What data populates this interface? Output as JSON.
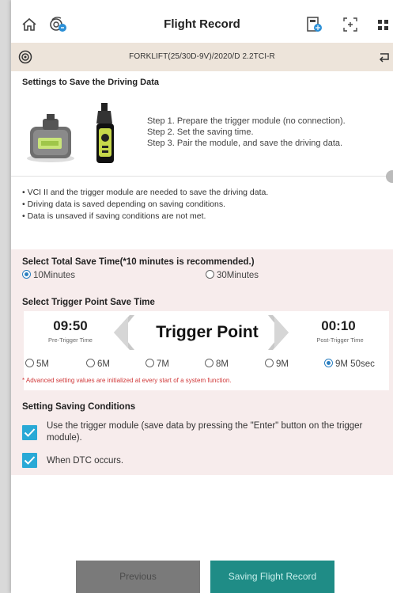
{
  "header": {
    "title": "Flight Record",
    "icons": [
      "home-icon",
      "vci-connection-icon",
      "battery-vci-icon",
      "screen-capture-icon",
      "apps-grid-icon"
    ]
  },
  "vehicle": {
    "text": "FORKLIFT(25/30D-9V)/2020/D 2.2TCI-R",
    "icons": [
      "gear-badge-icon",
      "return-icon"
    ]
  },
  "settings_section": {
    "title": "Settings to Save the Driving Data",
    "steps": [
      "Step 1. Prepare the trigger module (no connection).",
      "Step 2. Set the saving time.",
      "Step 3. Pair the module, and save the driving data."
    ],
    "bullets": [
      "• VCI II and the trigger module are needed to save the driving data.",
      "• Driving data is saved depending on saving conditions.",
      "• Data is unsaved if saving conditions are not met."
    ]
  },
  "total_save_time": {
    "title": "Select Total Save Time(*10 minutes is recommended.)",
    "options": [
      "10Minutes",
      "30Minutes"
    ],
    "selected": "10Minutes"
  },
  "trigger_point": {
    "title": "Select Trigger Point Save Time",
    "pre_time": "09:50",
    "pre_label": "Pre-Trigger Time",
    "center_label": "Trigger Point",
    "post_time": "00:10",
    "post_label": "Post-Trigger Time",
    "options": [
      "5M",
      "6M",
      "7M",
      "8M",
      "9M",
      "9M 50sec"
    ],
    "selected": "9M 50sec",
    "note": "* Advanced setting values are initialized at every start of a system function."
  },
  "saving_conditions": {
    "title": "Setting Saving Conditions",
    "items": [
      {
        "label": "Use the trigger module (save data by pressing the \"Enter\" button on the trigger module).",
        "checked": true
      },
      {
        "label": "When DTC occurs.",
        "checked": true
      }
    ]
  },
  "buttons": {
    "previous": "Previous",
    "save": "Saving Flight Record"
  },
  "colors": {
    "accent": "#29a9d6",
    "save_button": "#1f8c86",
    "note": "#d0393a",
    "section_bg": "#f7ecec",
    "vehicle_bar": "#ede4da"
  }
}
